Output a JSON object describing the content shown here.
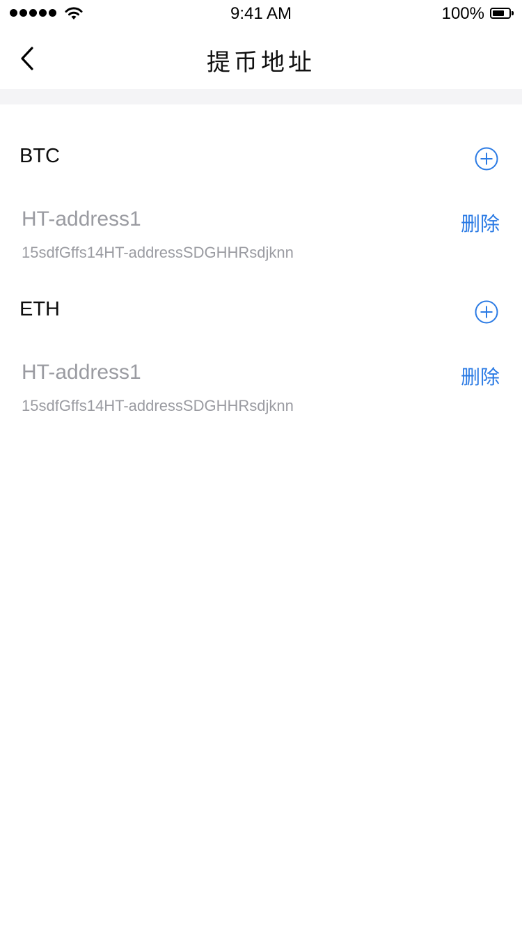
{
  "status_bar": {
    "time": "9:41 AM",
    "battery_percent": "100%",
    "battery_level": 1.0,
    "signal_icon": "signal-dots-icon",
    "wifi_icon": "wifi-icon",
    "battery_icon": "battery-icon"
  },
  "nav": {
    "title": "提币地址",
    "back_icon": "chevron-left-icon"
  },
  "colors": {
    "accent": "#2a7ae4",
    "muted_text": "#9a9ba1",
    "divider": "#f4f4f6"
  },
  "sections": [
    {
      "currency": "BTC",
      "add_icon": "plus-circle-icon",
      "addresses": [
        {
          "name": "HT-address1",
          "address": "15sdfGffs14HT-addressSDGHHRsdjknn",
          "delete_label": "删除"
        }
      ]
    },
    {
      "currency": "ETH",
      "add_icon": "plus-circle-icon",
      "addresses": [
        {
          "name": "HT-address1",
          "address": "15sdfGffs14HT-addressSDGHHRsdjknn",
          "delete_label": "删除"
        }
      ]
    }
  ]
}
